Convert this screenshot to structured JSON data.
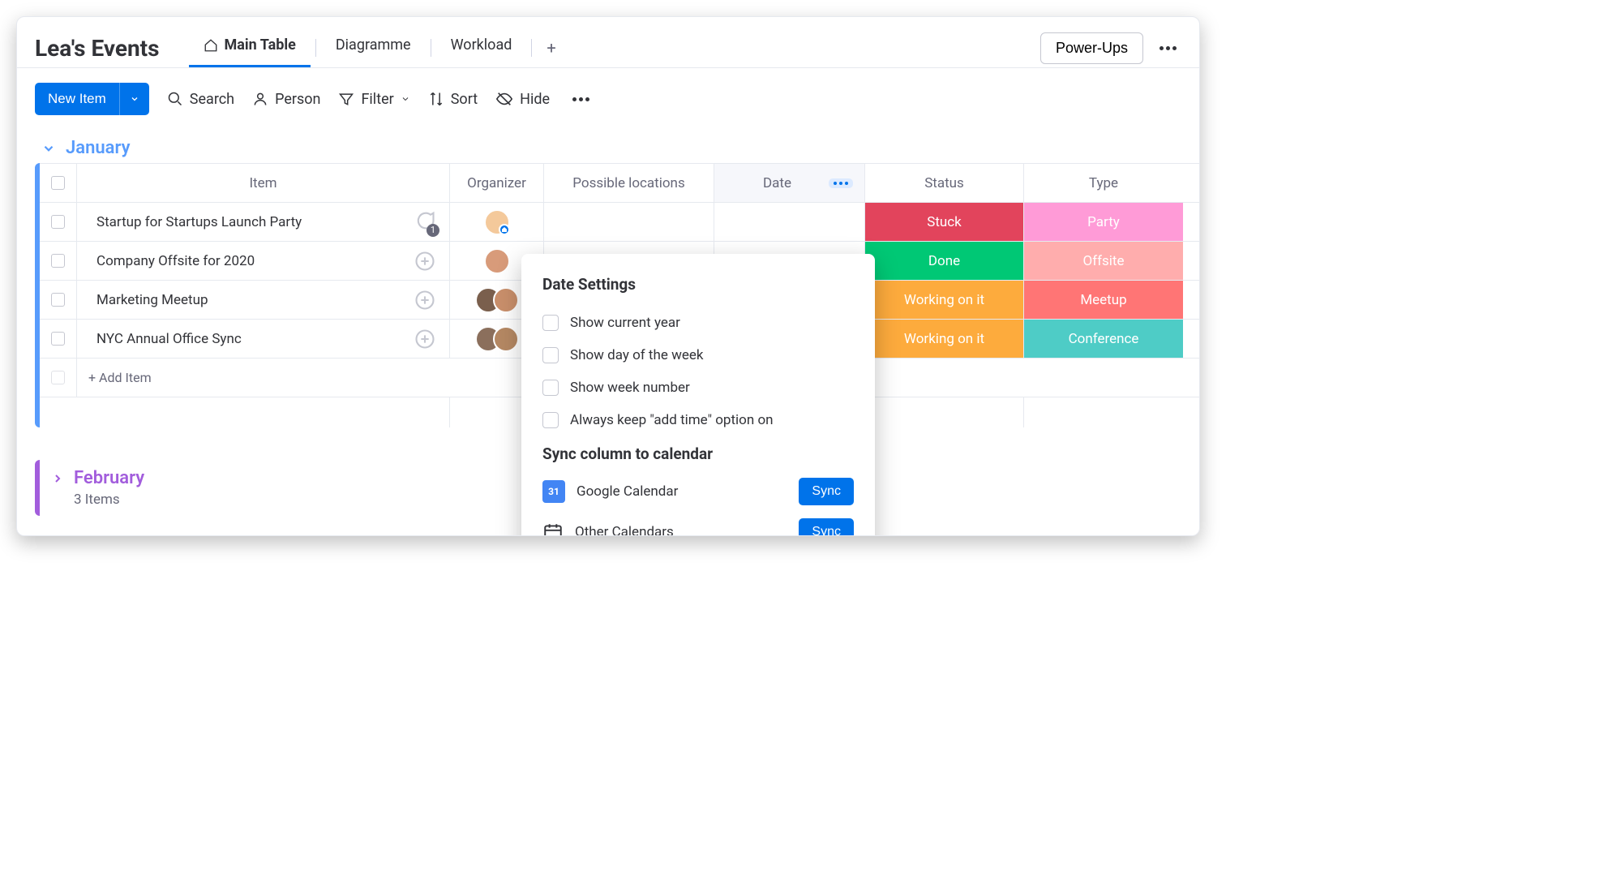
{
  "board": {
    "title": "Lea's Events"
  },
  "tabs": {
    "main": "Main Table",
    "diagram": "Diagramme",
    "workload": "Workload"
  },
  "header_buttons": {
    "powerups": "Power-Ups"
  },
  "toolbar": {
    "new_item": "New Item",
    "search": "Search",
    "person": "Person",
    "filter": "Filter",
    "sort": "Sort",
    "hide": "Hide"
  },
  "groups": {
    "january": {
      "title": "January"
    },
    "february": {
      "title": "February",
      "count": "3 Items"
    }
  },
  "columns": {
    "item": "Item",
    "organizer": "Organizer",
    "locations": "Possible locations",
    "date": "Date",
    "status": "Status",
    "type": "Type"
  },
  "rows": [
    {
      "name": "Startup for Startups Launch Party",
      "chat_badge": "1",
      "status": "Stuck",
      "status_class": "st-stuck",
      "type": "Party",
      "type_class": "ty-party"
    },
    {
      "name": "Company Offsite for 2020",
      "chat_badge": "",
      "status": "Done",
      "status_class": "st-done",
      "type": "Offsite",
      "type_class": "ty-off"
    },
    {
      "name": "Marketing Meetup",
      "chat_badge": "",
      "status": "Working on it",
      "status_class": "st-work",
      "type": "Meetup",
      "type_class": "ty-meet"
    },
    {
      "name": "NYC Annual Office Sync",
      "chat_badge": "",
      "status": "Working on it",
      "status_class": "st-work",
      "type": "Conference",
      "type_class": "ty-conf"
    }
  ],
  "add_item": "+ Add Item",
  "popover": {
    "title": "Date Settings",
    "opt_year": "Show current year",
    "opt_day": "Show day of the week",
    "opt_week": "Show week number",
    "opt_addtime": "Always keep \"add time\" option on",
    "sync_title": "Sync column to calendar",
    "gcal": "Google Calendar",
    "gcal_day": "31",
    "other": "Other Calendars",
    "sync_btn": "Sync"
  }
}
